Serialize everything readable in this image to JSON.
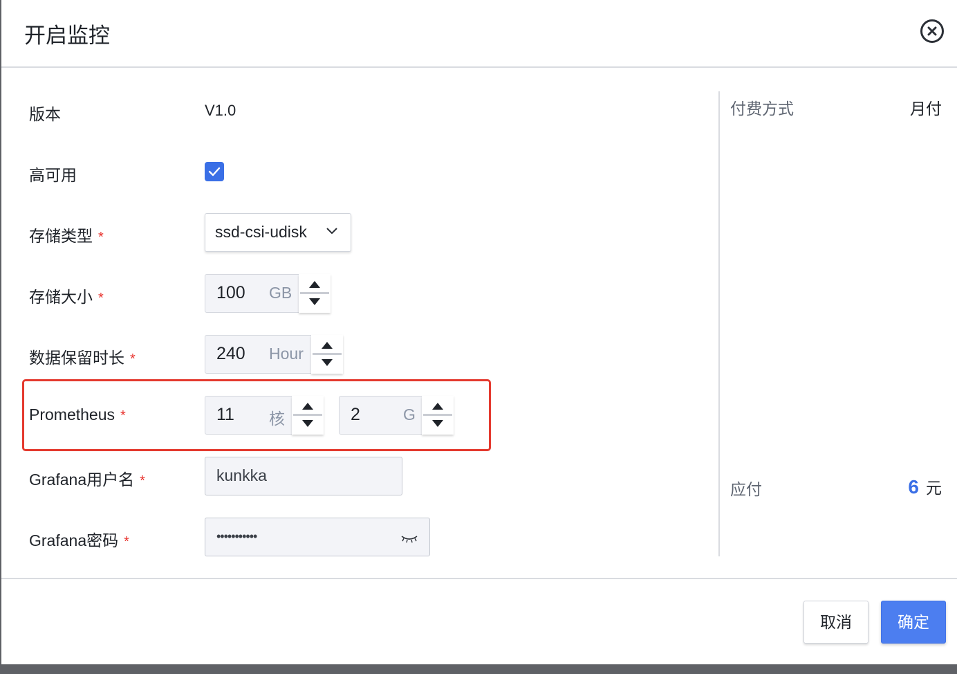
{
  "dialog": {
    "title": "开启监控"
  },
  "form": {
    "version": {
      "label": "版本",
      "value": "V1.0"
    },
    "high_availability": {
      "label": "高可用",
      "checked": true
    },
    "storage_type": {
      "label": "存储类型",
      "required_mark": "*",
      "value": "ssd-csi-udisk"
    },
    "storage_size": {
      "label": "存储大小",
      "required_mark": "*",
      "value": "100",
      "unit": "GB"
    },
    "retention": {
      "label": "数据保留时长",
      "required_mark": "*",
      "value": "240",
      "unit": "Hour"
    },
    "prometheus": {
      "label": "Prometheus",
      "required_mark": "*",
      "cpu": {
        "value": "11",
        "unit": "核"
      },
      "memory": {
        "value": "2",
        "unit": "G"
      }
    },
    "grafana_user": {
      "label": "Grafana用户名",
      "required_mark": "*",
      "value": "kunkka"
    },
    "grafana_password": {
      "label": "Grafana密码",
      "required_mark": "*",
      "value": "•••••••••••"
    }
  },
  "sidebar": {
    "payment_method": {
      "label": "付费方式",
      "value": "月付"
    },
    "payable": {
      "label": "应付",
      "amount": "6",
      "currency": "元"
    }
  },
  "footer": {
    "cancel_label": "取消",
    "confirm_label": "确定"
  },
  "colors": {
    "accent": "#3a6fe6",
    "required": "#e8322d",
    "highlight": "#e4392e"
  }
}
